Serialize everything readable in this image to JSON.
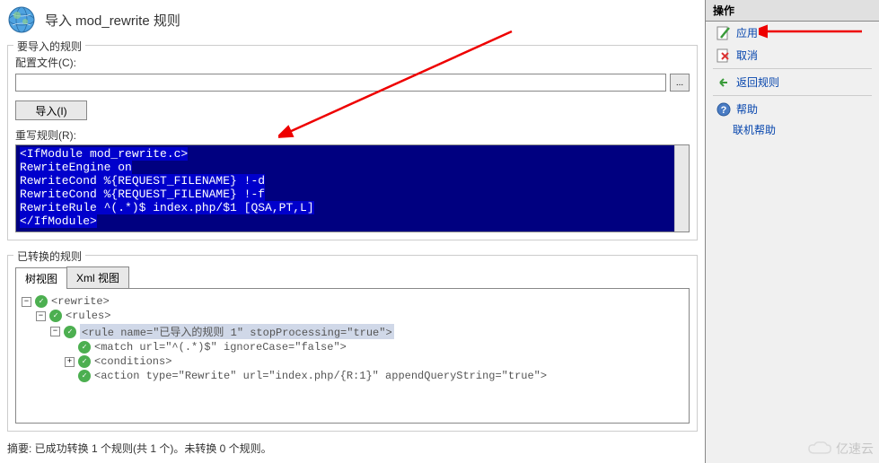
{
  "header": {
    "title": "导入 mod_rewrite 规则"
  },
  "import_section": {
    "legend": "要导入的规则",
    "config_label": "配置文件(C):",
    "config_value": "",
    "browse_label": "...",
    "import_btn": "导入(I)",
    "rewrite_label": "重写规则(R):",
    "code_lines": [
      "<IfModule mod_rewrite.c>",
      "RewriteEngine on",
      "RewriteCond %{REQUEST_FILENAME} !-d",
      "RewriteCond %{REQUEST_FILENAME} !-f",
      "RewriteRule ^(.*)$ index.php/$1 [QSA,PT,L]",
      "</IfModule>"
    ]
  },
  "converted_section": {
    "legend": "已转换的规则",
    "tabs": [
      "树视图",
      "Xml 视图"
    ],
    "tree": {
      "rewrite": "<rewrite>",
      "rules": "<rules>",
      "rule": "<rule name=\"已导入的规则 1\" stopProcessing=\"true\">",
      "match": "<match url=\"^(.*)$\" ignoreCase=\"false\">",
      "conditions": "<conditions>",
      "action": "<action type=\"Rewrite\" url=\"index.php/{R:1}\" appendQueryString=\"true\">"
    }
  },
  "summary": "摘要: 已成功转换 1 个规则(共 1 个)。未转换 0 个规则。",
  "actions": {
    "header": "操作",
    "apply": "应用",
    "cancel": "取消",
    "back": "返回规则",
    "help": "帮助",
    "online_help": "联机帮助"
  },
  "watermark": "亿速云"
}
